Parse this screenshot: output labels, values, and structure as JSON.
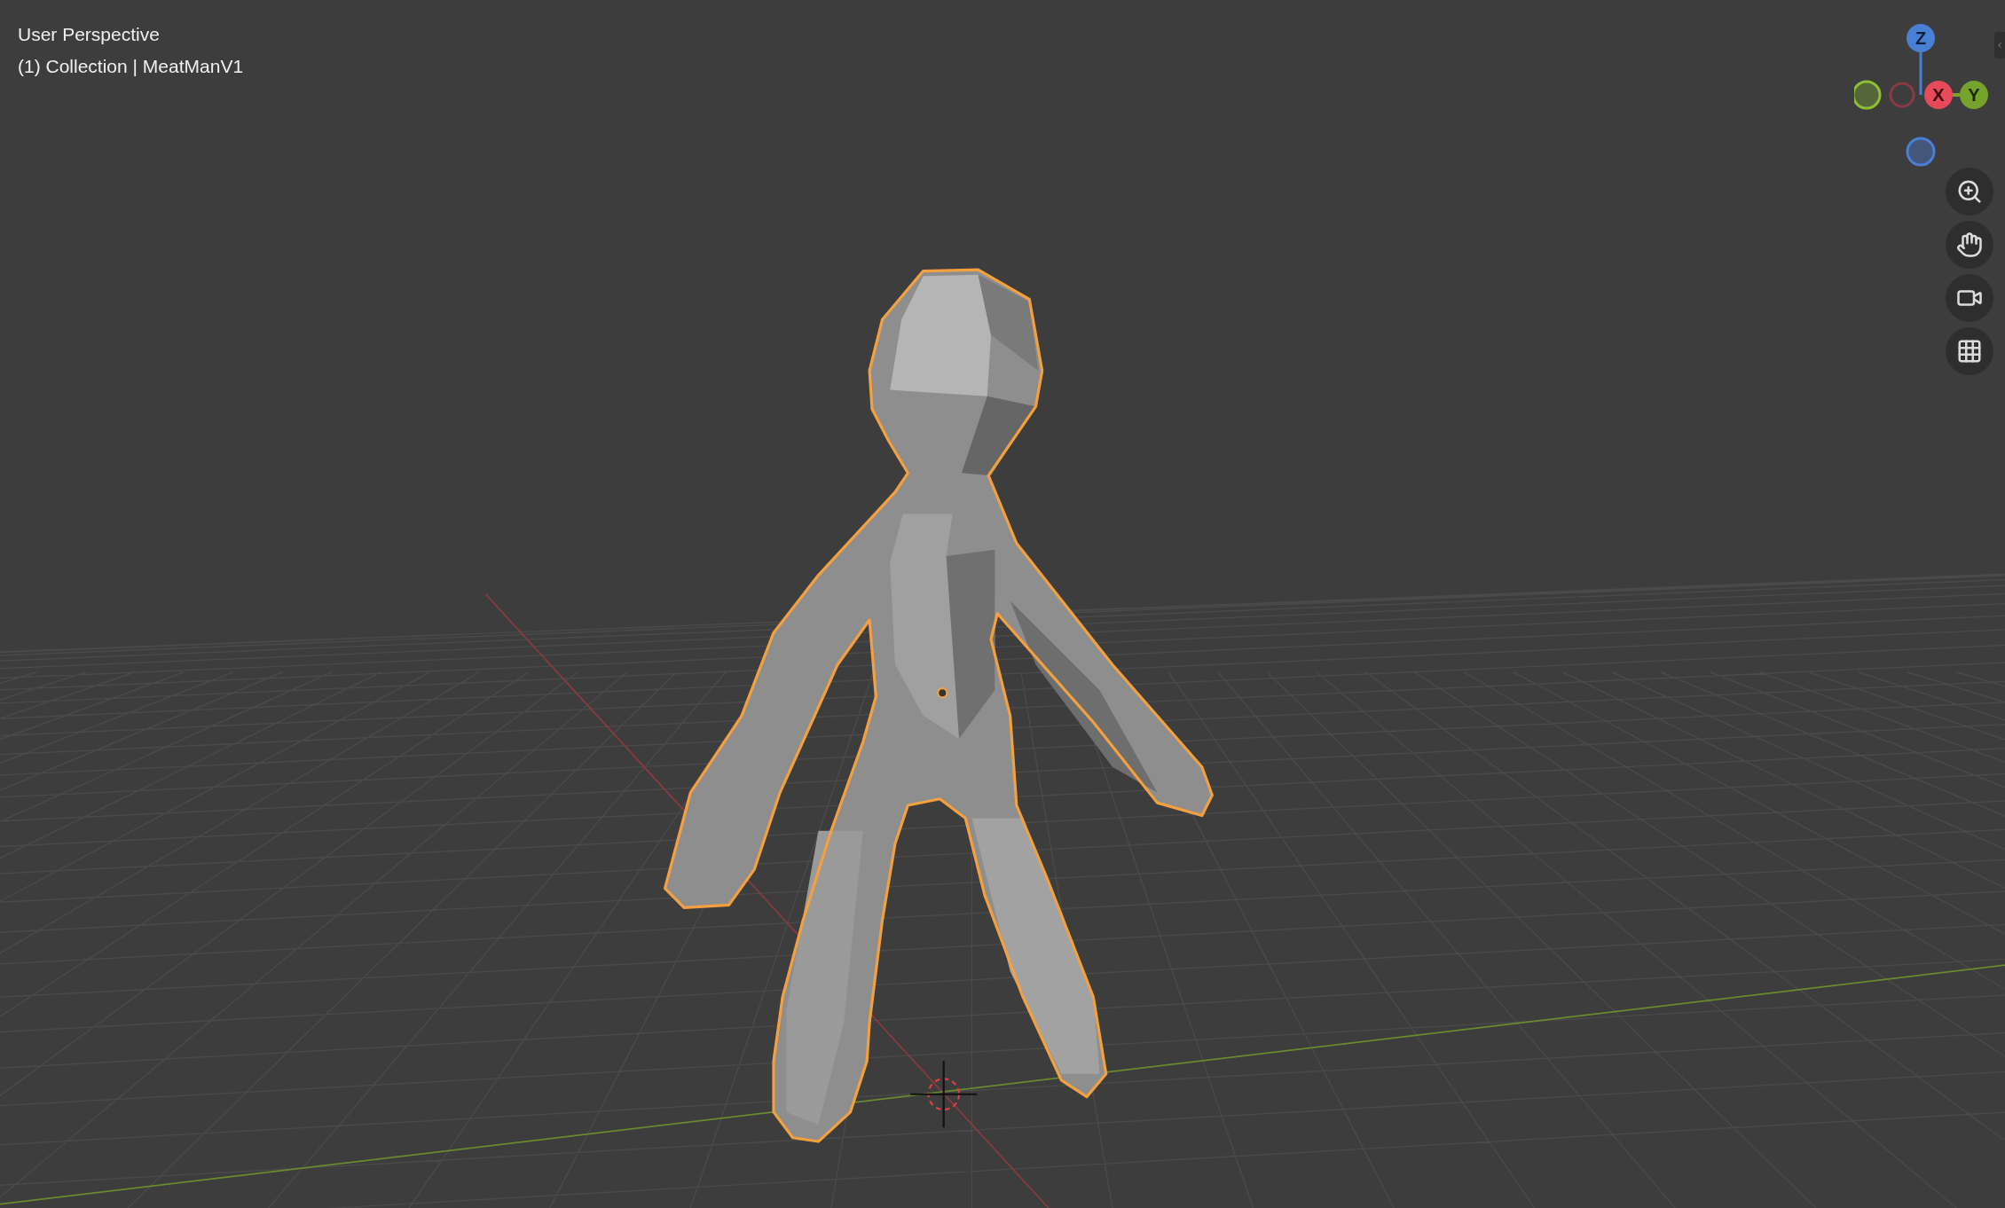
{
  "viewport": {
    "view_name": "User Perspective",
    "object_info": "(1) Collection | MeatManV1"
  },
  "gizmo": {
    "axes": [
      {
        "label": "Z"
      },
      {
        "label": "X"
      },
      {
        "label": "Y"
      }
    ]
  }
}
